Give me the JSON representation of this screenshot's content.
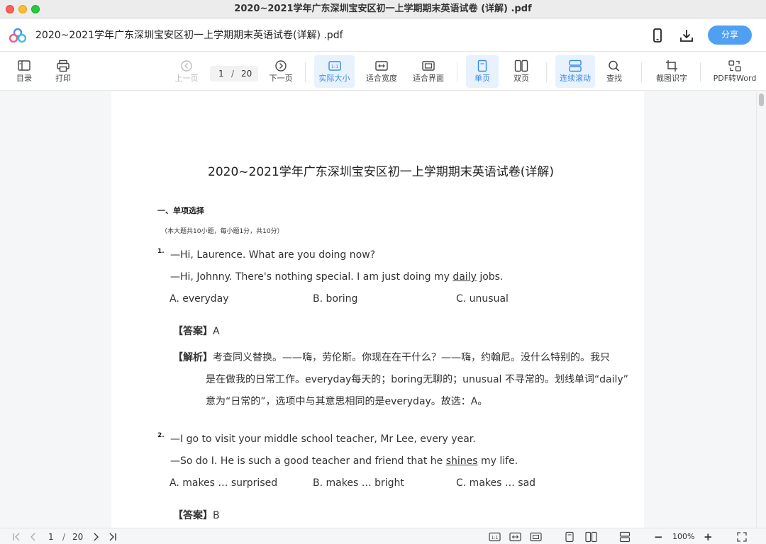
{
  "window": {
    "title": "2020~2021学年广东深圳宝安区初一上学期期末英语试卷 (详解) .pdf"
  },
  "header": {
    "doc_title": "2020~2021学年广东深圳宝安区初一上学期期末英语试卷(详解) .pdf",
    "share_label": "分享"
  },
  "toolbar": {
    "toc": "目录",
    "print": "打印",
    "prev_page": "上一页",
    "page_current": "1",
    "page_sep": "/",
    "page_total": "20",
    "next_page": "下一页",
    "actual_size": "实际大小",
    "fit_width": "适合宽度",
    "fit_page": "适合界面",
    "single_page": "单页",
    "double_page": "双页",
    "continuous_scroll": "连续滚动",
    "find": "查找",
    "screenshot_ocr": "截图识字",
    "pdf_to_word": "PDF转Word",
    "active_color": "#3b8ae6"
  },
  "document": {
    "title": "2020~2021学年广东深圳宝安区初一上学期期末英语试卷(详解)",
    "section_title": "一、单项选择",
    "section_note": "（本大题共10小题，每小题1分，共10分）",
    "questions": [
      {
        "number": "1.",
        "line1": "—Hi, Laurence. What are you doing now?",
        "line2_pre": "—Hi, Johnny. There's nothing special. I am just doing my ",
        "line2_u": "daily",
        "line2_post": " jobs.",
        "options": [
          "A. everyday",
          "B. boring",
          "C. unusual"
        ],
        "answer_label": "【答案】",
        "answer": "A",
        "analysis_label": "【解析】",
        "analysis_lines": [
          "考查同义替换。——嗨，劳伦斯。你现在在干什么？——嗨，约翰尼。没什么特别的。我只",
          "是在做我的日常工作。everyday每天的；boring无聊的；unusual 不寻常的。划线单词“daily”",
          "意为“日常的”，选项中与其意思相同的是everyday。故选：A。"
        ]
      },
      {
        "number": "2.",
        "line1": "—I go to visit your middle school teacher, Mr Lee, every year.",
        "line2_pre": "—So do I. He is such a good teacher and friend that he ",
        "line2_u": "shines",
        "line2_post": " my life.",
        "options": [
          "A. makes … surprised",
          "B. makes … bright",
          "C. makes … sad"
        ],
        "answer_label": "【答案】",
        "answer": "B"
      }
    ]
  },
  "statusbar": {
    "page_current": "1",
    "page_sep": "/",
    "page_total": "20",
    "zoom": "100%",
    "minus": "−",
    "plus": "+"
  }
}
